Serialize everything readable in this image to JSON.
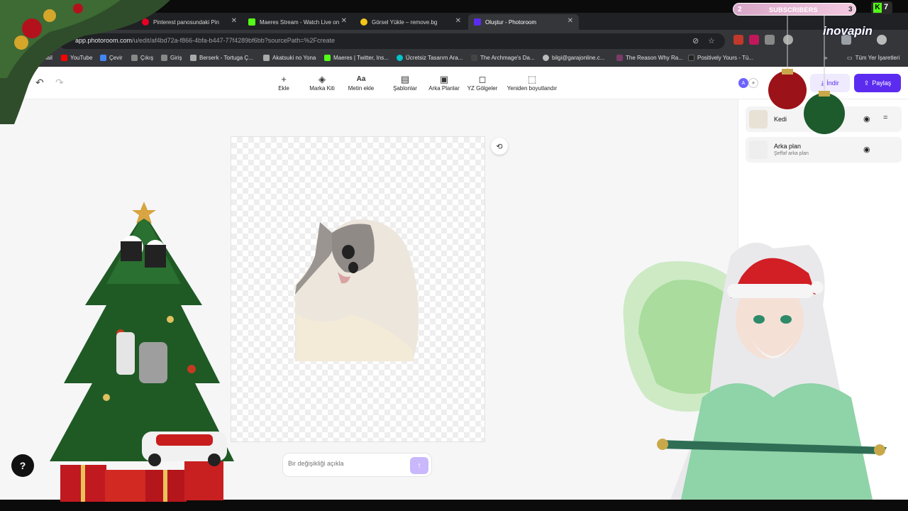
{
  "browser": {
    "tabs": [
      {
        "title": "Pinterest panosundaki Pin",
        "favicon_color": "#e60023"
      },
      {
        "title": "Maeres Stream - Watch Live on",
        "favicon_color": "#53fc18"
      },
      {
        "title": "Görsel Yükle – remove.bg",
        "favicon_color": "#f5c518"
      },
      {
        "title": "Oluştur - Photoroom",
        "favicon_color": "#5b2cf0",
        "active": true
      }
    ],
    "url_prefix": "app.photoroom.com",
    "url_rest": "/u/edit/af4bd72a-f866-4bfa-b447-77f4289bf6bb?sourcePath=%2Fcreate",
    "bookmarks": [
      {
        "label": "Gmail",
        "color": "#ea4335"
      },
      {
        "label": "YouTube",
        "color": "#ff0000"
      },
      {
        "label": "Çevir",
        "color": "#4285f4"
      },
      {
        "label": "Çıkış",
        "color": "#888888"
      },
      {
        "label": "Giriş",
        "color": "#888888"
      },
      {
        "label": "Berserk - Tortuga Ç...",
        "color": "#aaaaaa"
      },
      {
        "label": "Akatsuki no Yona",
        "color": "#aaaaaa"
      },
      {
        "label": "Maeres | Twitter, Ins...",
        "color": "#53fc18"
      },
      {
        "label": "Ücretsiz Tasarım Ara...",
        "color": "#00c4cc"
      },
      {
        "label": "The Archmage's Da...",
        "color": "#444444"
      },
      {
        "label": "bilgi@garajonline.c...",
        "color": "#bbbbbb"
      },
      {
        "label": "The Reason Why Ra...",
        "color": "#7a3b69"
      },
      {
        "label": "Positively Yours - Tü...",
        "color": "#222222"
      }
    ],
    "all_bookmarks": "Tüm Yer İşaretleri"
  },
  "toolbar": {
    "tools": [
      {
        "label": "Ekle",
        "icon": "+",
        "icon_name": "plus-icon"
      },
      {
        "label": "Marka Kiti",
        "icon": "◈",
        "icon_name": "brand-kit-icon"
      },
      {
        "label": "Metin ekle",
        "icon": "Aa",
        "icon_name": "text-icon"
      },
      {
        "label": "Şablonlar",
        "icon": "▤",
        "icon_name": "templates-icon"
      },
      {
        "label": "Arka Planlar",
        "icon": "▣",
        "icon_name": "backgrounds-icon"
      },
      {
        "label": "YZ Gölgeler",
        "icon": "◻",
        "icon_name": "ai-shadows-icon"
      },
      {
        "label": "Yeniden boyutlandır",
        "icon": "⬚",
        "icon_name": "resize-icon"
      }
    ],
    "avatar_initial": "A",
    "download_label": "İndir",
    "share_label": "Paylaş",
    "accent": "#5b2cf0"
  },
  "prompt": {
    "placeholder": "Bir değişikliği açıkla"
  },
  "layers": [
    {
      "name": "Kedi",
      "sub": ""
    },
    {
      "name": "Arka plan",
      "sub": "Şeffaf arka plan"
    }
  ],
  "stream": {
    "subs_label": "SUBSCRIBERS",
    "subs_left": "2",
    "subs_right": "3",
    "kick_count": "7",
    "watermark": "inovapin"
  }
}
